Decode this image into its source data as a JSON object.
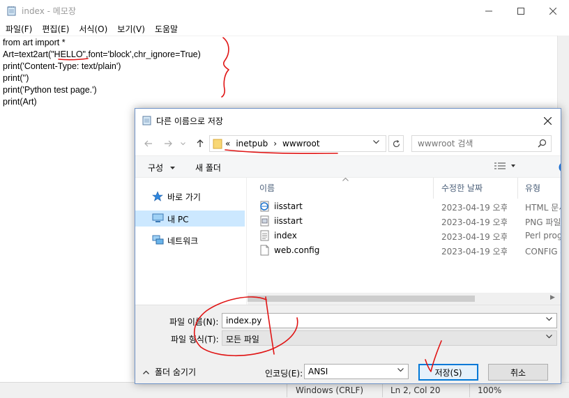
{
  "notepad": {
    "title": "index - 메모장",
    "menu": [
      "파일(F)",
      "편집(E)",
      "서식(O)",
      "보기(V)",
      "도움말"
    ],
    "lines": [
      "from art import *",
      "Art=text2art(\"HELLO\",font='block',chr_ignore=True)",
      "print('Content-Type: text/plain')",
      "print('')",
      "print('Python test page.')",
      "print(Art)"
    ],
    "status": {
      "encoding_line": "Windows (CRLF)",
      "position": "Ln 2, Col 20",
      "zoom": "100%"
    }
  },
  "dialog": {
    "title": "다른 이름으로 저장",
    "address": {
      "overflow": "«",
      "crumbs": [
        "inetpub",
        "wwwroot"
      ]
    },
    "search_placeholder": "wwwroot 검색",
    "toolbar": {
      "organize": "구성",
      "new_folder": "새 폴더"
    },
    "nav_items": [
      {
        "label": "바로 가기",
        "icon": "star-icon",
        "selected": false
      },
      {
        "label": "내 PC",
        "icon": "computer-icon",
        "selected": true
      },
      {
        "label": "네트워크",
        "icon": "network-icon",
        "selected": false
      }
    ],
    "columns": [
      "이름",
      "수정한 날짜",
      "유형"
    ],
    "files": [
      {
        "name": "iisstart",
        "date": "2023-04-19 오후 ...",
        "type": "HTML 문서",
        "icon": "html-file-icon"
      },
      {
        "name": "iisstart",
        "date": "2023-04-19 오후 ...",
        "type": "PNG 파일",
        "icon": "image-file-icon"
      },
      {
        "name": "index",
        "date": "2023-04-19 오후 ...",
        "type": "Perl program",
        "icon": "text-file-icon"
      },
      {
        "name": "web.config",
        "date": "2023-04-19 오후 ...",
        "type": "CONFIG 파일",
        "icon": "blank-file-icon"
      }
    ],
    "filename_label": "파일 이름(N):",
    "filename_value": "index.py",
    "filetype_label": "파일 형식(T):",
    "filetype_value": "모든 파일",
    "encoding_label": "인코딩(E):",
    "encoding_value": "ANSI",
    "save_button": "저장(S)",
    "cancel_button": "취소",
    "hide_folders": "폴더 숨기기"
  },
  "colors": {
    "accent": "#0078d7",
    "selection": "#cce8ff",
    "annotation": "#e01414"
  }
}
